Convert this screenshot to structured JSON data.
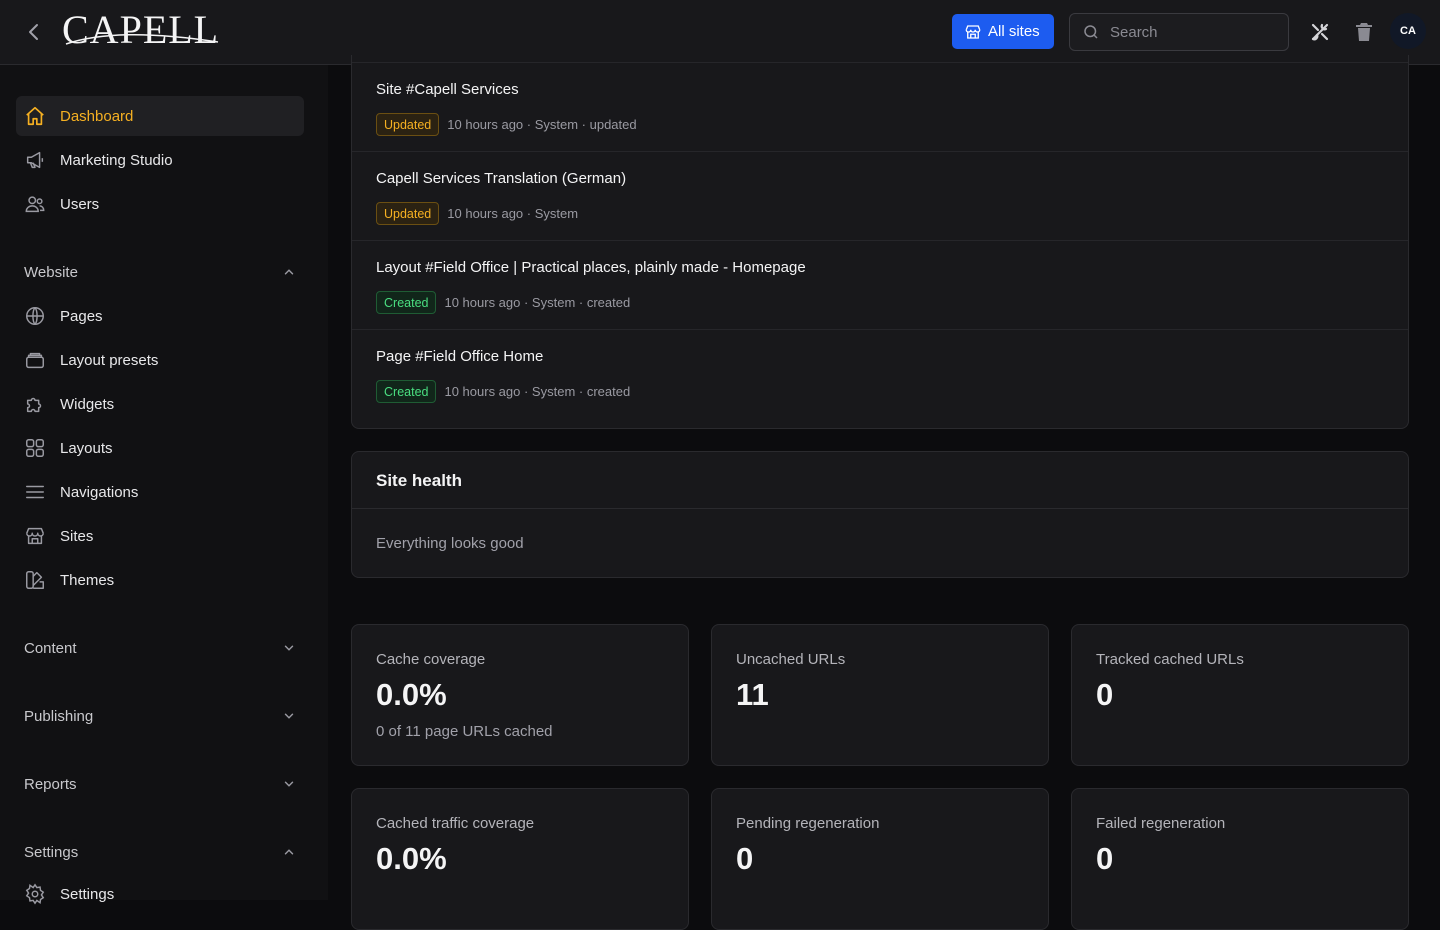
{
  "topbar": {
    "logo": "CAPELL",
    "all_sites_label": "All sites",
    "search_placeholder": "Search",
    "avatar_initials": "CA"
  },
  "sidebar": {
    "items_top": [
      {
        "label": "Dashboard",
        "icon": "home-icon",
        "active": true
      },
      {
        "label": "Marketing Studio",
        "icon": "megaphone-icon"
      },
      {
        "label": "Users",
        "icon": "users-icon"
      }
    ],
    "website": {
      "label": "Website",
      "expanded": true,
      "items": [
        {
          "label": "Pages",
          "icon": "globe-icon"
        },
        {
          "label": "Layout presets",
          "icon": "stack-icon"
        },
        {
          "label": "Widgets",
          "icon": "puzzle-icon"
        },
        {
          "label": "Layouts",
          "icon": "grid-icon"
        },
        {
          "label": "Navigations",
          "icon": "menu-icon"
        },
        {
          "label": "Sites",
          "icon": "storefront-icon"
        },
        {
          "label": "Themes",
          "icon": "swatch-icon"
        }
      ]
    },
    "sections": [
      {
        "label": "Content",
        "expanded": false
      },
      {
        "label": "Publishing",
        "expanded": false
      },
      {
        "label": "Reports",
        "expanded": false
      },
      {
        "label": "Settings",
        "expanded": true
      }
    ],
    "settings_item": {
      "label": "Settings",
      "icon": "gear-icon"
    }
  },
  "activity": [
    {
      "title": "Site #Capell Services",
      "status": "Updated",
      "meta": "10 hours ago · System · updated"
    },
    {
      "title": "Capell Services Translation (German)",
      "status": "Updated",
      "meta": "10 hours ago · System"
    },
    {
      "title": "Layout #Field Office | Practical places, plainly made - Homepage",
      "status": "Created",
      "meta": "10 hours ago · System · created"
    },
    {
      "title": "Page #Field Office Home",
      "status": "Created",
      "meta": "10 hours ago · System · created"
    }
  ],
  "site_health": {
    "title": "Site health",
    "message": "Everything looks good"
  },
  "stats": [
    {
      "label": "Cache coverage",
      "value": "0.0%",
      "sub": "0 of 11 page URLs cached"
    },
    {
      "label": "Uncached URLs",
      "value": "11",
      "sub": ""
    },
    {
      "label": "Tracked cached URLs",
      "value": "0",
      "sub": ""
    },
    {
      "label": "Cached traffic coverage",
      "value": "0.0%",
      "sub": ""
    },
    {
      "label": "Pending regeneration",
      "value": "0",
      "sub": ""
    },
    {
      "label": "Failed regeneration",
      "value": "0",
      "sub": ""
    }
  ],
  "colors": {
    "accent": "#f5b022",
    "primary": "#1d5cf0",
    "created": "#4ade80"
  }
}
